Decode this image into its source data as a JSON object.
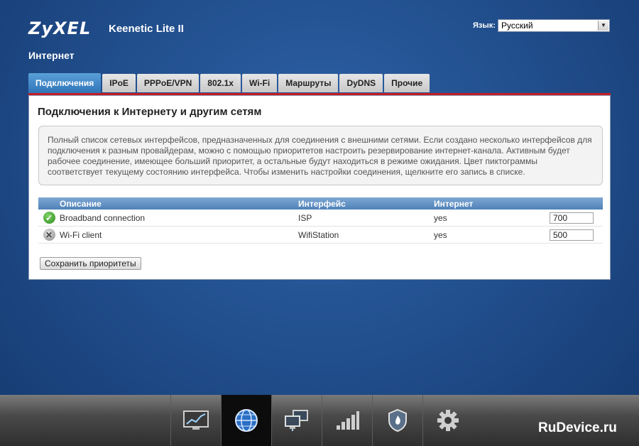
{
  "header": {
    "logo": "ZyXEL",
    "model": "Keenetic Lite II",
    "language_label": "Язык:",
    "language_value": "Русский"
  },
  "section_title": "Интернет",
  "tabs": [
    {
      "label": "Подключения",
      "active": true
    },
    {
      "label": "IPoE"
    },
    {
      "label": "PPPoE/VPN"
    },
    {
      "label": "802.1x"
    },
    {
      "label": "Wi-Fi"
    },
    {
      "label": "Маршруты"
    },
    {
      "label": "DyDNS"
    },
    {
      "label": "Прочие"
    }
  ],
  "panel": {
    "title": "Подключения к Интернету и другим сетям",
    "info": "Полный список сетевых интерфейсов, предназначенных для соединения с внешними сетями. Если создано несколько интерфейсов для подключения к разным провайдерам, можно с помощью приоритетов настроить резервирование интернет-канала. Активным будет рабочее соединение, имеющее больший приоритет, а остальные будут находиться в режиме ожидания. Цвет пиктограммы соответствует текущему состоянию интерфейса. Чтобы изменить настройки соединения, щелкните его запись в списке."
  },
  "table": {
    "headers": {
      "description": "Описание",
      "interface": "Интерфейс",
      "internet": "Интернет"
    },
    "rows": [
      {
        "status": "connected",
        "status_icon": "check-icon",
        "description": "Broadband connection",
        "interface": "ISP",
        "internet": "yes",
        "priority": "700"
      },
      {
        "status": "disconnected",
        "status_icon": "cross-icon",
        "description": "Wi-Fi client",
        "interface": "WifiStation",
        "internet": "yes",
        "priority": "500"
      }
    ]
  },
  "save_button": "Сохранить приоритеты",
  "nav": [
    {
      "icon": "monitor-chart-icon"
    },
    {
      "icon": "globe-icon",
      "active": true
    },
    {
      "icon": "network-computers-icon"
    },
    {
      "icon": "signal-bars-icon"
    },
    {
      "icon": "shield-icon"
    },
    {
      "icon": "gear-icon"
    }
  ],
  "watermark": "RuDevice.ru",
  "colors": {
    "accent_red": "#c21e25",
    "active_tab": "#2f74b8",
    "background": "#22508f"
  }
}
